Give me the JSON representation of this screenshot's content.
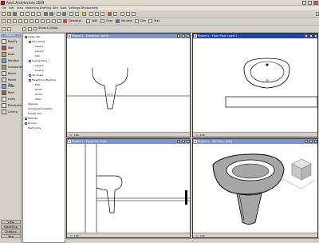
{
  "app": {
    "title": "Revit Architecture 2009"
  },
  "menu": [
    "File",
    "Edit",
    "View",
    "Modelling",
    "Drafting",
    "Site",
    "Tools",
    "Settings",
    "Window",
    "Help"
  ],
  "toolbar": {
    "demolish_label": "Demolish",
    "wall_label": "Wall",
    "door_label": "Door",
    "window_label": "Window",
    "dim_label": "Dim",
    "text_label": "Text",
    "help_placeholder": "Letter Search Help",
    "show_group_label": "Show a Group"
  },
  "left_panel": {
    "header": "Basics",
    "items": [
      "Modify",
      "Wall",
      "Door",
      "Window",
      "Component",
      "Room",
      "Room Tag",
      "Floor",
      "Roof",
      "Lines",
      "Dimension",
      "Ceiling"
    ],
    "tabs": [
      "View",
      "Modelling",
      "Drafting",
      "Site"
    ]
  },
  "browser": {
    "items": [
      "Views (all)",
      "Floor Plans",
      "Level 1",
      "Level 2",
      "Site",
      "Ceiling Plans",
      "Level 1",
      "Level 2",
      "3D Views",
      "Elevations (Building",
      "East",
      "North",
      "South",
      "West",
      "Legends",
      "Schedules/Quantitie",
      "Sheets (all)",
      "Families",
      "Groups",
      "Revit Links"
    ]
  },
  "views": [
    {
      "title": "Project1 - Elevation: North",
      "scale": "1 : 100"
    },
    {
      "title": "Project1 - Floor Plan: Level 1",
      "scale": "1 : 100"
    },
    {
      "title": "Project1 - Elevation: East",
      "scale": "1 : 100"
    },
    {
      "title": "Project1 - 3D View: {3D}",
      "scale": "1 : 100"
    }
  ]
}
